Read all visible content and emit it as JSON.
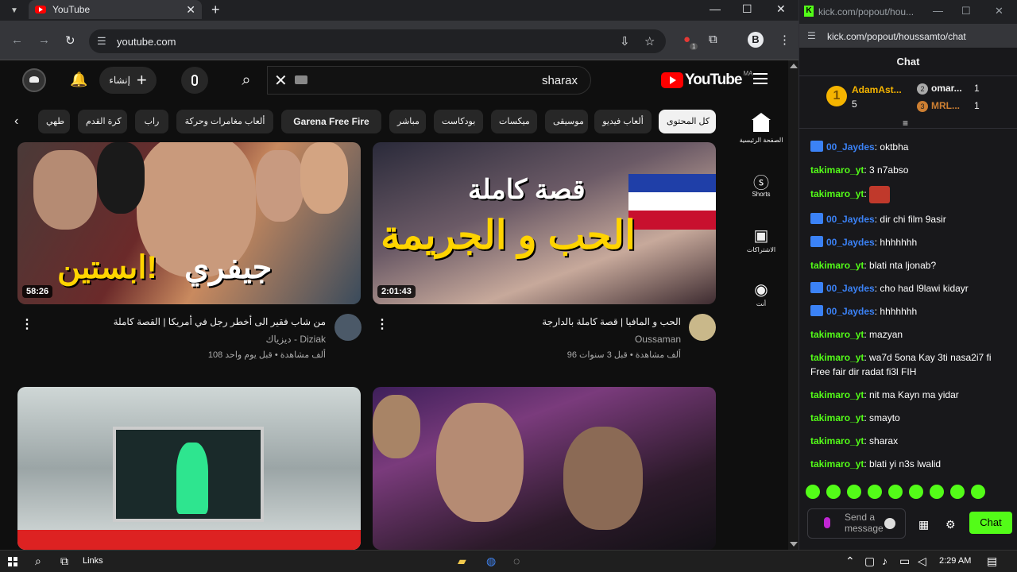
{
  "browser": {
    "tab_title": "YouTube",
    "new_tab": "+",
    "url": "youtube.com",
    "ext_badge": "1",
    "profile": "B"
  },
  "youtube": {
    "logo_text": "YouTube",
    "country": "MA",
    "search_query": "sharax",
    "create_label": "إنشاء",
    "chips": [
      {
        "label": "كل المحتوى"
      },
      {
        "label": "ألعاب فيديو"
      },
      {
        "label": "موسيقى"
      },
      {
        "label": "ميكسات"
      },
      {
        "label": "بودكاست"
      },
      {
        "label": "مباشر"
      },
      {
        "label": "Garena Free Fire"
      },
      {
        "label": "ألعاب مغامرات وحركة"
      },
      {
        "label": "راب"
      },
      {
        "label": "كرة القدم"
      },
      {
        "label": "طهي"
      }
    ],
    "rail": [
      {
        "label": "الصفحة الرئيسية"
      },
      {
        "label": "Shorts"
      },
      {
        "label": "الاشتراكات"
      },
      {
        "label": "أنت"
      }
    ],
    "videos": [
      {
        "thumb_text1": "جيفري",
        "thumb_text2": "ابستين!",
        "duration": "58:26",
        "title": "من شاب فقير الى أخطر رجل في أمريكا | القصة كاملة",
        "channel": "ديزياك - Diziak",
        "stats": "108 ألف مشاهدة • قبل يوم واحد"
      },
      {
        "thumb_text1": "قصة كاملة",
        "thumb_text2": "الحب و الجريمة",
        "duration": "2:01:43",
        "title": "الحب و المافيا | قصة كاملة بالدارجة",
        "channel": "Oussaman",
        "stats": "96 ألف مشاهدة • قبل 3 سنوات"
      }
    ]
  },
  "kick": {
    "window_title": "kick.com/popout/hou...",
    "url": "kick.com/popout/houssamto/chat",
    "chat_title": "Chat",
    "gifters": [
      {
        "rank": "1",
        "name": "AdamAst...",
        "count": "5"
      },
      {
        "rank": "2",
        "name": "omar...",
        "count": "1"
      },
      {
        "rank": "3",
        "name": "MRL...",
        "count": "1"
      }
    ],
    "messages": [
      {
        "user": "00_Jaydes",
        "text": "oktbha",
        "badge": true
      },
      {
        "user": "takimaro_yt",
        "text": "3 n7abso",
        "badge": false
      },
      {
        "user": "takimaro_yt",
        "text": "",
        "badge": false,
        "emote": true
      },
      {
        "user": "00_Jaydes",
        "text": "dir chi film 9asir",
        "badge": true
      },
      {
        "user": "00_Jaydes",
        "text": "hhhhhhh",
        "badge": true
      },
      {
        "user": "takimaro_yt",
        "text": "blati nta ljonab?",
        "badge": false
      },
      {
        "user": "00_Jaydes",
        "text": "cho had l9lawi kidayr",
        "badge": true
      },
      {
        "user": "00_Jaydes",
        "text": "hhhhhhh",
        "badge": true
      },
      {
        "user": "takimaro_yt",
        "text": "mazyan",
        "badge": false
      },
      {
        "user": "takimaro_yt",
        "text": "wa7d 5ona Kay 3ti nasa2i7 fi Free fair dir radat fi3l FIH",
        "badge": false
      },
      {
        "user": "takimaro_yt",
        "text": "nit ma Kayn ma yidar",
        "badge": false
      },
      {
        "user": "takimaro_yt",
        "text": "smayto",
        "badge": false
      },
      {
        "user": "takimaro_yt",
        "text": "sharax",
        "badge": false
      },
      {
        "user": "takimaro_yt",
        "text": "blati yi n3s lwalid",
        "badge": false
      }
    ],
    "input_placeholder": "Send a message",
    "chat_button": "Chat"
  },
  "taskbar": {
    "links_label": "Links",
    "time": "2:29 AM"
  }
}
